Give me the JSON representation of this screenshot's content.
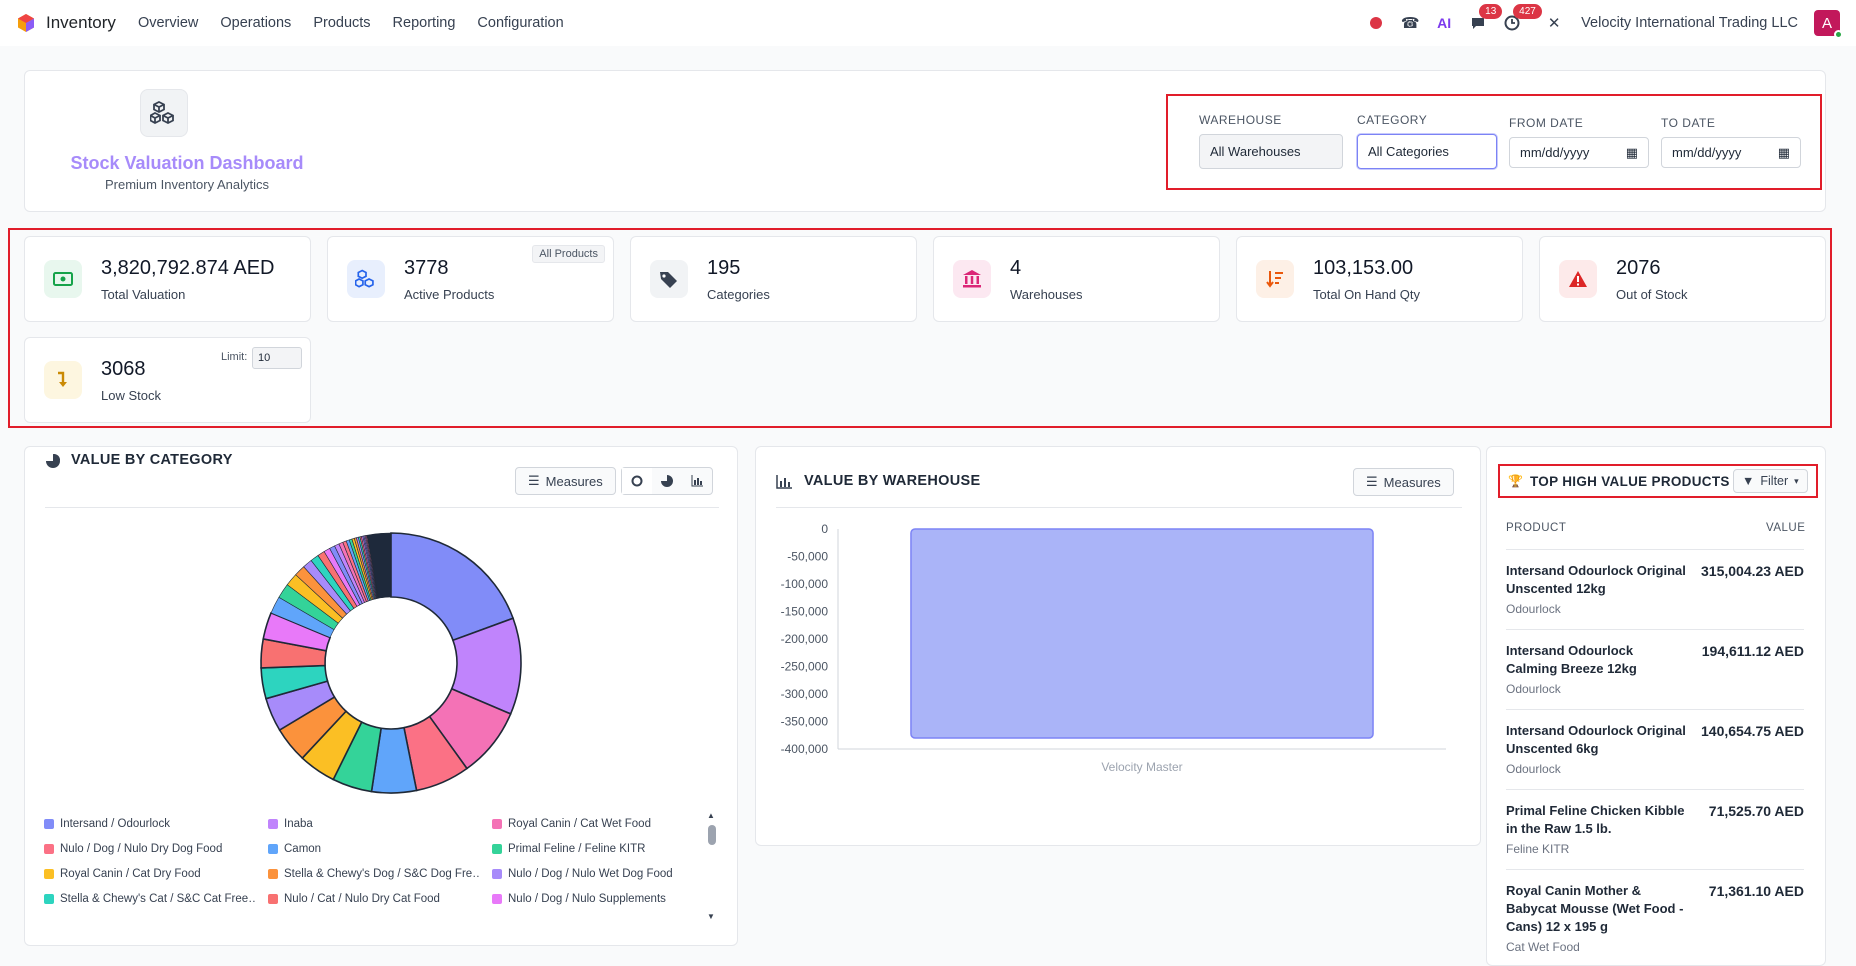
{
  "nav": {
    "app": "Inventory",
    "menu": [
      "Overview",
      "Operations",
      "Products",
      "Reporting",
      "Configuration"
    ],
    "chat_badge": "13",
    "activity_badge": "427",
    "company": "Velocity International Trading LLC",
    "avatar_letter": "A"
  },
  "header": {
    "title": "Stock Valuation Dashboard",
    "subtitle": "Premium Inventory Analytics"
  },
  "filters": {
    "warehouse_label": "WAREHOUSE",
    "warehouse_value": "All Warehouses",
    "category_label": "CATEGORY",
    "category_value": "All Categories",
    "from_label": "FROM DATE",
    "from_value": "mm/dd/yyyy",
    "to_label": "TO DATE",
    "to_value": "mm/dd/yyyy"
  },
  "kpis": [
    {
      "value": "3,820,792.874 AED",
      "label": "Total Valuation",
      "color": "#16a34a",
      "bg": "#e8f7ee"
    },
    {
      "value": "3778",
      "label": "Active Products",
      "tag": "All Products",
      "color": "#2563eb",
      "bg": "#e8effd"
    },
    {
      "value": "195",
      "label": "Categories",
      "color": "#374151",
      "bg": "#f1f3f5"
    },
    {
      "value": "4",
      "label": "Warehouses",
      "color": "#db2777",
      "bg": "#fce8f1"
    },
    {
      "value": "103,153.00",
      "label": "Total On Hand Qty",
      "color": "#ea580c",
      "bg": "#fdf0e6"
    },
    {
      "value": "2076",
      "label": "Out of Stock",
      "color": "#dc2626",
      "bg": "#fdeaea"
    },
    {
      "value": "3068",
      "label": "Low Stock",
      "limit_label": "Limit:",
      "limit_value": "10",
      "color": "#ca8a04",
      "bg": "#fdf6e0"
    }
  ],
  "category_panel": {
    "title": "VALUE BY CATEGORY",
    "measures": "Measures",
    "legend": [
      {
        "name": "Intersand / Odourlock",
        "color": "#818cf8"
      },
      {
        "name": "Inaba",
        "color": "#c084fc"
      },
      {
        "name": "Royal Canin / Cat Wet Food",
        "color": "#f472b6"
      },
      {
        "name": "Nulo / Dog / Nulo Dry Dog Food",
        "color": "#fb7185"
      },
      {
        "name": "Camon",
        "color": "#60a5fa"
      },
      {
        "name": "Primal Feline / Feline KITR",
        "color": "#34d399"
      },
      {
        "name": "Royal Canin / Cat Dry Food",
        "color": "#fbbf24"
      },
      {
        "name": "Stella & Chewy's Dog / S&C Dog Fre…",
        "color": "#fb923c"
      },
      {
        "name": "Nulo / Dog / Nulo Wet Dog Food",
        "color": "#a78bfa"
      },
      {
        "name": "Stella & Chewy's Cat / S&C Cat Free…",
        "color": "#2dd4bf"
      },
      {
        "name": "Nulo / Cat / Nulo Dry Cat Food",
        "color": "#f87171"
      },
      {
        "name": "Nulo / Dog / Nulo Supplements",
        "color": "#e879f9"
      }
    ]
  },
  "warehouse_panel": {
    "title": "VALUE BY WAREHOUSE",
    "measures": "Measures"
  },
  "chart_data": [
    {
      "type": "pie",
      "variant": "doughnut",
      "categories": [
        "Intersand / Odourlock",
        "Inaba",
        "Royal Canin / Cat Wet Food",
        "Nulo / Dog / Nulo Dry Dog Food",
        "Camon",
        "Primal Feline / Feline KITR",
        "Royal Canin / Cat Dry Food",
        "Stella & Chewy's Dog / S&C Dog Fre…",
        "Nulo / Dog / Nulo Wet Dog Food",
        "Stella & Chewy's Cat / S&C Cat Free…",
        "Nulo / Cat / Nulo Dry Cat Food",
        "Nulo / Dog / Nulo Supplements"
      ],
      "values": [
        315004.23,
        194611.12,
        140654.75,
        110000,
        90000,
        80000,
        75000,
        72000,
        68000,
        62000,
        58000,
        54000
      ],
      "other_slice_count": 24,
      "other_colors": [
        "#60a5fa",
        "#34d399",
        "#fbbf24",
        "#fb923c",
        "#a78bfa",
        "#2dd4bf",
        "#f87171",
        "#e879f9",
        "#818cf8",
        "#c084fc",
        "#f472b6",
        "#fb7185"
      ],
      "legend_position": "bottom"
    },
    {
      "type": "bar",
      "categories": [
        "Velocity Master"
      ],
      "values": [
        -380000
      ],
      "ylim": [
        -400000,
        0
      ],
      "yticks": [
        "0",
        "-50,000",
        "-100,000",
        "-150,000",
        "-200,000",
        "-250,000",
        "-300,000",
        "-350,000",
        "-400,000"
      ],
      "grid": false,
      "color": "#aab4f8"
    }
  ],
  "top_products": {
    "title": "TOP HIGH VALUE PRODUCTS",
    "filter": "Filter",
    "col_product": "PRODUCT",
    "col_value": "VALUE",
    "items": [
      {
        "name": "Intersand Odourlock Original Unscented 12kg",
        "category": "Odourlock",
        "value": "315,004.23 AED"
      },
      {
        "name": "Intersand Odourlock Calming Breeze 12kg",
        "category": "Odourlock",
        "value": "194,611.12 AED"
      },
      {
        "name": "Intersand Odourlock Original Unscented 6kg",
        "category": "Odourlock",
        "value": "140,654.75 AED"
      },
      {
        "name": "Primal Feline Chicken Kibble in the Raw 1.5 lb.",
        "category": "Feline KITR",
        "value": "71,525.70 AED"
      },
      {
        "name": "Royal Canin Mother & Babycat Mousse (Wet Food - Cans) 12 x 195 g",
        "category": "Cat Wet Food",
        "value": "71,361.10 AED"
      }
    ]
  }
}
